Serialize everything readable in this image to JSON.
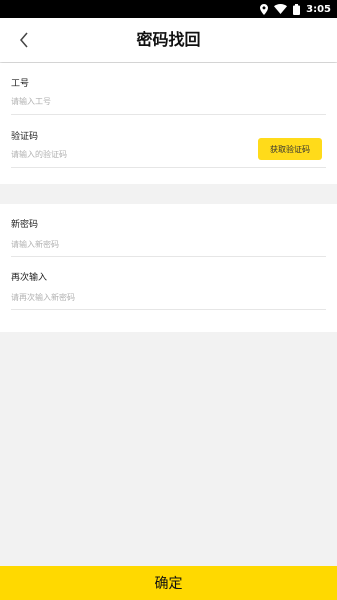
{
  "status_bar": {
    "time": "3:05"
  },
  "header": {
    "title": "密码找回"
  },
  "form": {
    "employee_id": {
      "label": "工号",
      "placeholder": "请输入工号"
    },
    "verification_code": {
      "label": "验证码",
      "placeholder": "请输入的验证码",
      "button_label": "获取验证码"
    },
    "new_password": {
      "label": "新密码",
      "placeholder": "请输入新密码"
    },
    "confirm_password": {
      "label": "再次输入",
      "placeholder": "请再次输入新密码"
    }
  },
  "footer": {
    "confirm_label": "确定"
  },
  "colors": {
    "accent": "#FFDB1A",
    "background": "#F2F2F2"
  }
}
